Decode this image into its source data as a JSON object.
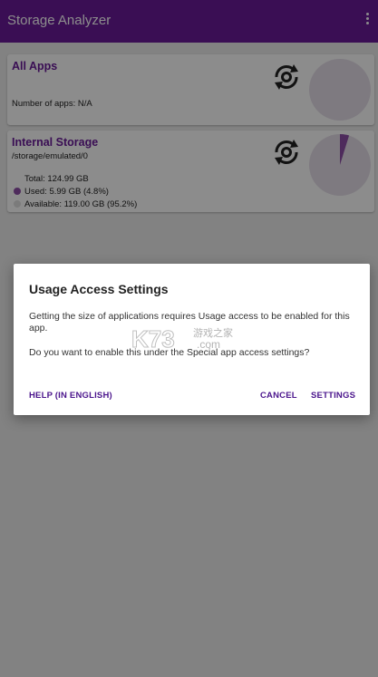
{
  "appbar": {
    "title": "Storage Analyzer",
    "menu_icon": "more-vert-icon"
  },
  "cards": {
    "all_apps": {
      "title": "All Apps",
      "count_text": "Number of apps: N/A",
      "refresh_icon": "refresh-icon",
      "used_fraction": 0
    },
    "internal": {
      "title": "Internal Storage",
      "path": "/storage/emulated/0",
      "total": "Total: 124.99 GB",
      "used": "Used: 5.99 GB (4.8%)",
      "available": "Available: 119.00 GB (95.2%)",
      "used_fraction": 0.048,
      "refresh_icon": "refresh-icon"
    }
  },
  "dialog": {
    "title": "Usage Access Settings",
    "message": "Getting the size of applications requires Usage access to be enabled for this app.",
    "question": "Do you want to enable this under the Special app access settings?",
    "help_label": "HELP (IN ENGLISH)",
    "cancel_label": "CANCEL",
    "settings_label": "SETTINGS"
  },
  "watermark": {
    "text": "K73",
    "suffix": ".com",
    "cn": "游戏之家"
  },
  "colors": {
    "primary": "#6a1b9a",
    "pie_bg": "#e6dfea",
    "used": "#8e4fa8",
    "available": "#e0e0e0"
  }
}
